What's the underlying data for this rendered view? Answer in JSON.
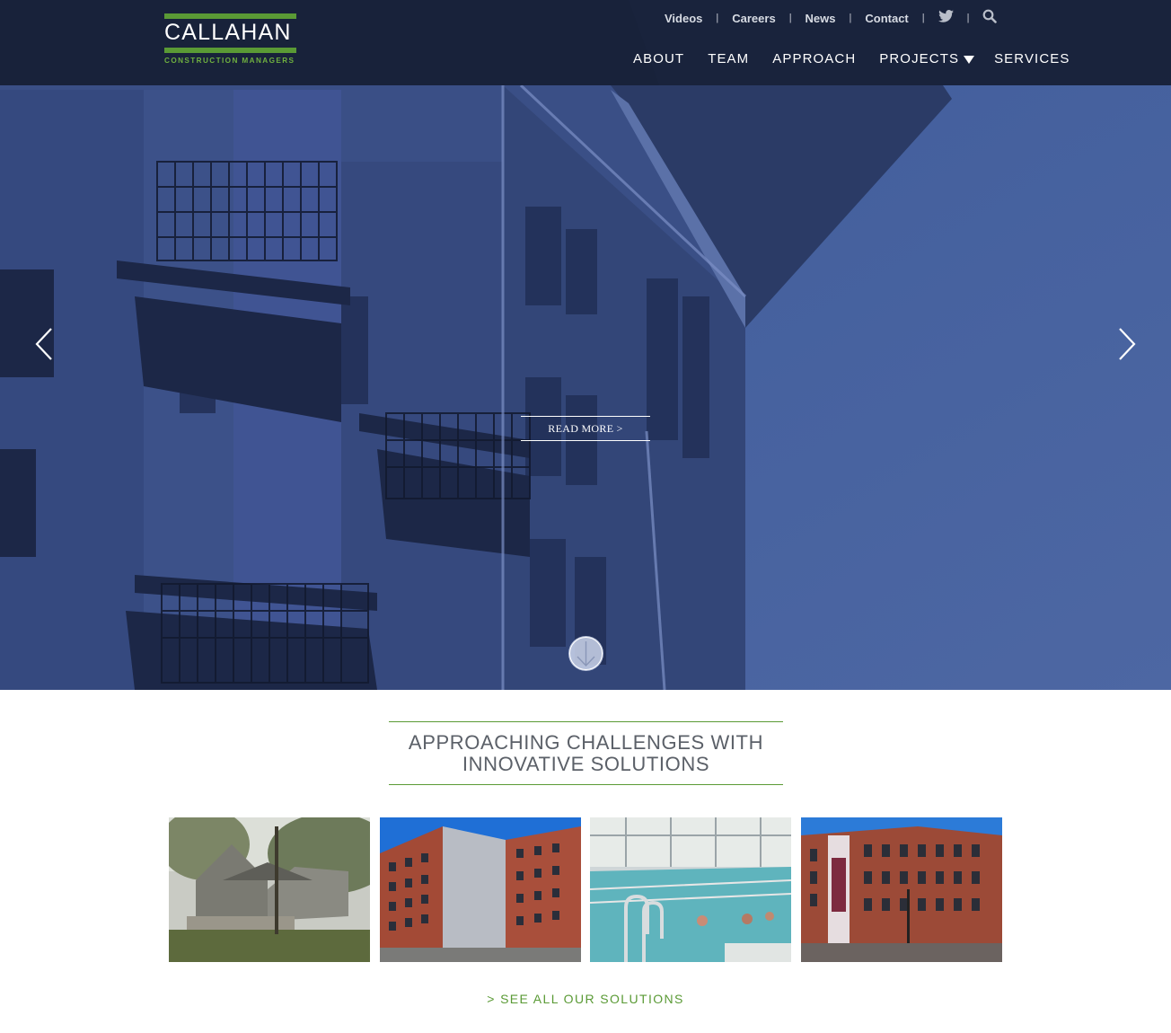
{
  "brand": {
    "name": "CALLAHAN",
    "tagline": "CONSTRUCTION MANAGERS",
    "green": "#5a9a35",
    "header_bg": "#161e34"
  },
  "utility_nav": {
    "links": [
      "Videos",
      "Careers",
      "News",
      "Contact"
    ],
    "icons": [
      "twitter-icon",
      "search-icon"
    ]
  },
  "main_nav": {
    "items": [
      "ABOUT",
      "TEAM",
      "APPROACH",
      "PROJECTS",
      "SERVICES"
    ]
  },
  "hero": {
    "read_more": "READ MORE >",
    "prev_icon": "chevron-left-icon",
    "next_icon": "chevron-right-icon",
    "scroll_icon": "arrow-down-icon"
  },
  "section": {
    "title_line1": "APPROACHING CHALLENGES WITH",
    "title_line2": "INNOVATIVE SOLUTIONS",
    "cards": [
      "barn-house-rendering",
      "brick-apartment-tower",
      "indoor-pool",
      "brick-mill-building"
    ],
    "see_all": "> SEE ALL OUR SOLUTIONS"
  }
}
